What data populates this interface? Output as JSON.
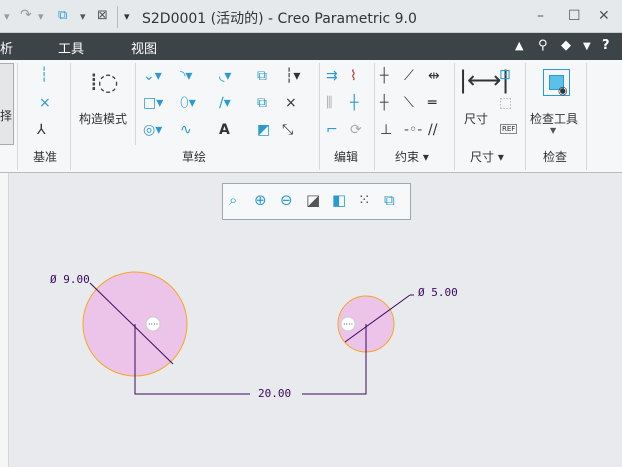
{
  "titlebar": {
    "title": "S2D0001 (活动的) - Creo Parametric 9.0",
    "minimize": "–",
    "maximize": "☐",
    "close": "✕"
  },
  "menubar": {
    "items": [
      "析",
      "工具",
      "视图"
    ],
    "right_icons": [
      "collapse-ribbon-icon",
      "search-icon",
      "hat-icon",
      "dropdown-icon",
      "help-icon"
    ],
    "help": "?"
  },
  "ribbon": {
    "select_partial": "择",
    "groups": {
      "datum": "基准",
      "sketch": "草绘",
      "edit": "编辑",
      "constrain": "约束 ▾",
      "dimension": "尺寸 ▾",
      "inspect": "检查"
    },
    "construction_mode": "构造模式",
    "dimension_button": "尺寸",
    "inspect_tools": "检查工具",
    "ref": "REF"
  },
  "sketch": {
    "dim_large": "Ø 9.00",
    "dim_small": "Ø 5.00",
    "dim_distance": "20.00",
    "colors": {
      "fill": "#ecc4ea",
      "outline": "#f5a623",
      "dim": "#3a0a5c"
    }
  }
}
